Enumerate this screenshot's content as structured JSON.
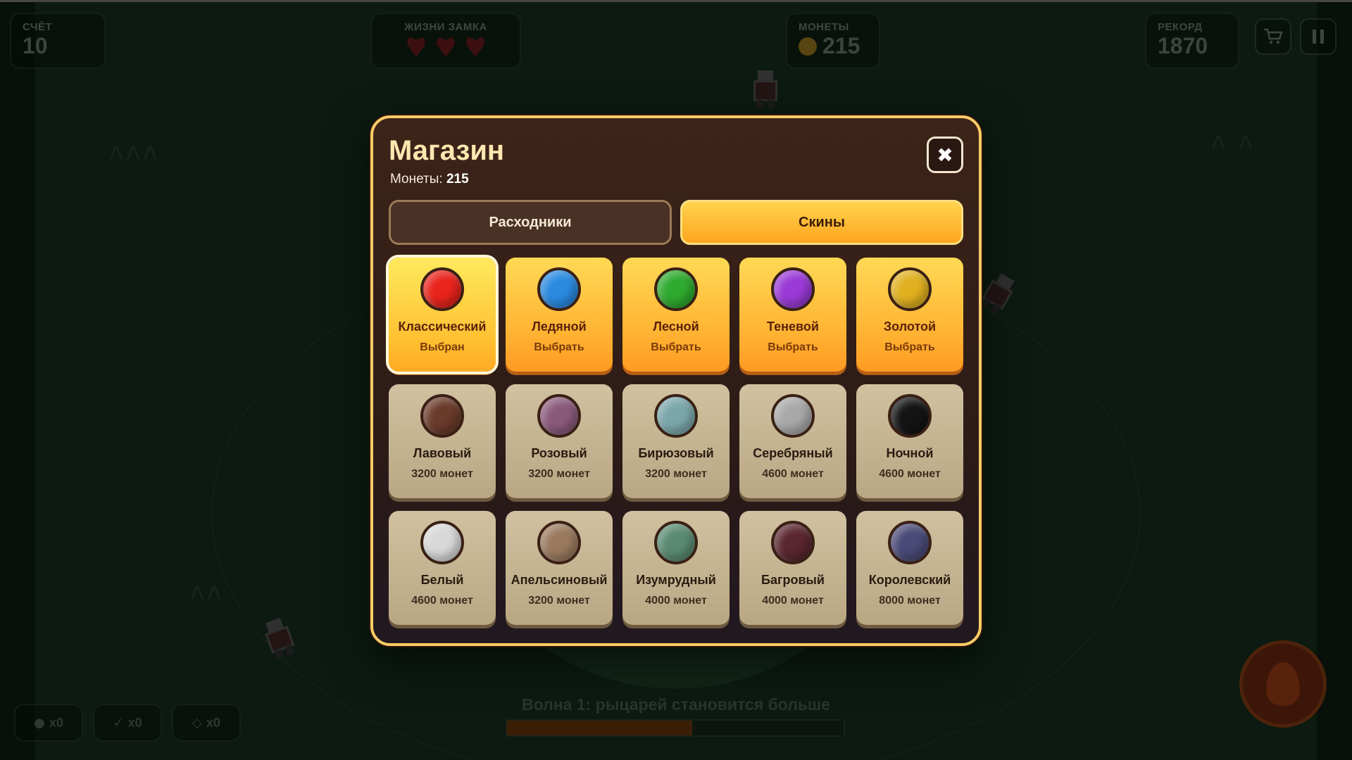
{
  "hud": {
    "score": {
      "label": "СЧЁТ",
      "value": "10"
    },
    "lives": {
      "label": "ЖИЗНИ ЗАМКА",
      "count": 3
    },
    "coins": {
      "label": "МОНЕТЫ",
      "value": "215"
    },
    "record": {
      "label": "РЕКОРД",
      "value": "1870"
    },
    "shop_icon": "cart-icon",
    "pause_icon": "pause-icon"
  },
  "powerups": [
    {
      "icon": "bomb-icon",
      "label": "x0"
    },
    {
      "icon": "arrow-icon",
      "label": "x0"
    },
    {
      "icon": "shield-icon",
      "label": "x0"
    }
  ],
  "wave": {
    "text": "Волна 1: рыцарей становится больше",
    "progress": 0.55
  },
  "shop": {
    "title": "Магазин",
    "coins_label": "Монеты:",
    "coins_value": "215",
    "close_icon": "close-icon",
    "tabs": [
      {
        "label": "Расходники",
        "active": false
      },
      {
        "label": "Скины",
        "active": true
      }
    ],
    "skins": [
      {
        "name": "Классический",
        "sub": "Выбран",
        "color": "#e8241c",
        "state": "selected"
      },
      {
        "name": "Ледяной",
        "sub": "Выбрать",
        "color": "#2a8ae0",
        "state": "owned"
      },
      {
        "name": "Лесной",
        "sub": "Выбрать",
        "color": "#2eaa2e",
        "state": "owned"
      },
      {
        "name": "Теневой",
        "sub": "Выбрать",
        "color": "#9a3ad6",
        "state": "owned"
      },
      {
        "name": "Золотой",
        "sub": "Выбрать",
        "color": "#e0b020",
        "state": "owned"
      },
      {
        "name": "Лавовый",
        "sub": "3200 монет",
        "color": "#6a3a2a",
        "state": "locked"
      },
      {
        "name": "Розовый",
        "sub": "3200 монет",
        "color": "#8a5a7a",
        "state": "locked"
      },
      {
        "name": "Бирюзовый",
        "sub": "3200 монет",
        "color": "#7aa6aa",
        "state": "locked"
      },
      {
        "name": "Серебряный",
        "sub": "4600 монет",
        "color": "#a8a8a8",
        "state": "locked"
      },
      {
        "name": "Ночной",
        "sub": "4600 монет",
        "color": "#141414",
        "state": "locked"
      },
      {
        "name": "Белый",
        "sub": "4600 монет",
        "color": "#d8d8d8",
        "state": "locked"
      },
      {
        "name": "Апельсиновый",
        "sub": "3200 монет",
        "color": "#9a7a5e",
        "state": "locked"
      },
      {
        "name": "Изумрудный",
        "sub": "4000 монет",
        "color": "#5a8a72",
        "state": "locked"
      },
      {
        "name": "Багровый",
        "sub": "4000 монет",
        "color": "#5a2630",
        "state": "locked"
      },
      {
        "name": "Королевский",
        "sub": "8000 монет",
        "color": "#4a4a78",
        "state": "locked"
      }
    ]
  }
}
